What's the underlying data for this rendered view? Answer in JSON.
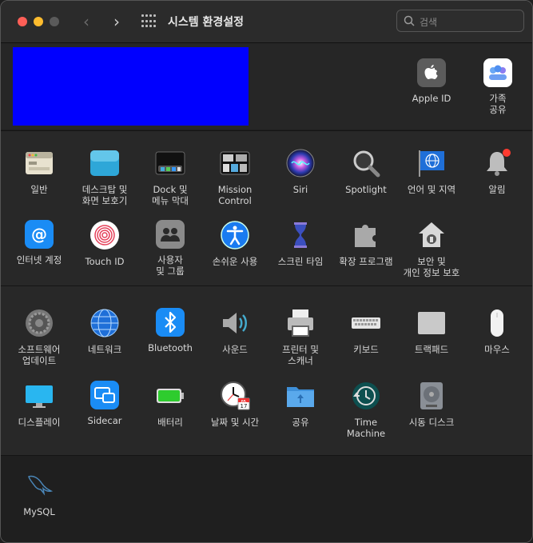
{
  "window": {
    "title": "시스템 환경설정"
  },
  "search": {
    "placeholder": "검색"
  },
  "top_items": [
    {
      "label": "Apple ID",
      "icon": "apple-icon"
    },
    {
      "label": "가족\n공유",
      "icon": "family-icon"
    }
  ],
  "row1": [
    {
      "label": "일반",
      "icon": "general-icon"
    },
    {
      "label": "데스크탑 및\n화면 보호기",
      "icon": "desktop-icon"
    },
    {
      "label": "Dock 및\n메뉴 막대",
      "icon": "dock-icon"
    },
    {
      "label": "Mission\nControl",
      "icon": "mission-control-icon"
    },
    {
      "label": "Siri",
      "icon": "siri-icon"
    },
    {
      "label": "Spotlight",
      "icon": "spotlight-icon"
    },
    {
      "label": "언어 및 지역",
      "icon": "globe-flag-icon"
    },
    {
      "label": "알림",
      "icon": "bell-icon"
    }
  ],
  "row2": [
    {
      "label": "인터넷 계정",
      "icon": "at-icon"
    },
    {
      "label": "Touch ID",
      "icon": "fingerprint-icon"
    },
    {
      "label": "사용자\n및 그룹",
      "icon": "users-icon"
    },
    {
      "label": "손쉬운 사용",
      "icon": "accessibility-icon"
    },
    {
      "label": "스크린 타임",
      "icon": "hourglass-icon"
    },
    {
      "label": "확장 프로그램",
      "icon": "puzzle-icon"
    },
    {
      "label": "보안 및\n개인 정보 보호",
      "icon": "house-lock-icon"
    }
  ],
  "row3": [
    {
      "label": "소프트웨어\n업데이트",
      "icon": "gear-icon"
    },
    {
      "label": "네트워크",
      "icon": "network-globe-icon"
    },
    {
      "label": "Bluetooth",
      "icon": "bluetooth-icon"
    },
    {
      "label": "사운드",
      "icon": "speaker-icon"
    },
    {
      "label": "프린터 및\n스캐너",
      "icon": "printer-icon"
    },
    {
      "label": "키보드",
      "icon": "keyboard-icon"
    },
    {
      "label": "트랙패드",
      "icon": "trackpad-icon"
    },
    {
      "label": "마우스",
      "icon": "mouse-icon"
    }
  ],
  "row4": [
    {
      "label": "디스플레이",
      "icon": "display-icon"
    },
    {
      "label": "Sidecar",
      "icon": "sidecar-icon"
    },
    {
      "label": "배터리",
      "icon": "battery-icon"
    },
    {
      "label": "날짜 및 시간",
      "icon": "clock-calendar-icon"
    },
    {
      "label": "공유",
      "icon": "folder-icon"
    },
    {
      "label": "Time\nMachine",
      "icon": "time-machine-icon"
    },
    {
      "label": "시동 디스크",
      "icon": "disk-icon"
    }
  ],
  "row5": [
    {
      "label": "MySQL",
      "icon": "mysql-dolphin-icon"
    }
  ],
  "calendar_day": "17",
  "calendar_month": "JUL"
}
